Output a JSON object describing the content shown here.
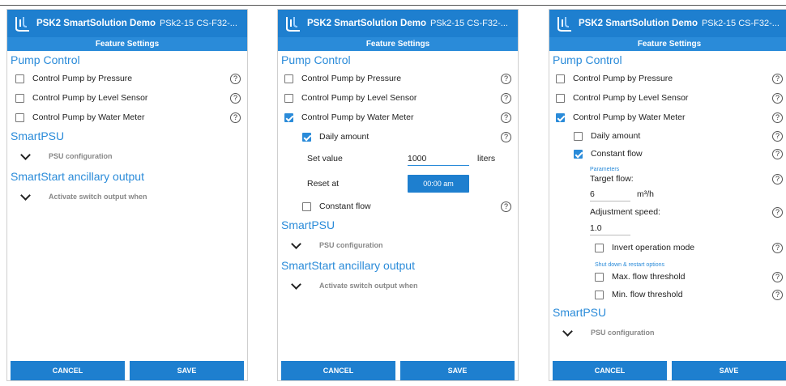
{
  "app": {
    "title": "PSK2 SmartSolution Demo",
    "subtitle": "PSk2-15 CS-F32-...",
    "subbar": "Feature Settings"
  },
  "common": {
    "pump_control": "Pump Control",
    "by_pressure": "Control Pump by Pressure",
    "by_level": "Control Pump by Level Sensor",
    "by_water_meter": "Control Pump by Water Meter",
    "smartpsu": "SmartPSU",
    "psu_configuration": "PSU configuration",
    "smartstart": "SmartStart ancillary output",
    "activate_switch": "Activate switch output when",
    "help": "?",
    "cancel": "CANCEL",
    "save": "SAVE"
  },
  "screen2": {
    "daily_amount": "Daily amount",
    "set_value_label": "Set value",
    "set_value": "1000",
    "liters": "liters",
    "reset_at_label": "Reset at",
    "reset_at": "00:00 am",
    "constant_flow": "Constant flow"
  },
  "screen3": {
    "daily_amount": "Daily amount",
    "constant_flow": "Constant flow",
    "parameters": "Parameters",
    "target_flow_label": "Target flow:",
    "target_flow": "6",
    "target_flow_unit": "m³/h",
    "adjustment_speed_label": "Adjustment speed:",
    "adjustment_speed": "1.0",
    "invert_operation": "Invert operation mode",
    "shutdown_caption": "Shut down & restart options",
    "max_flow": "Max. flow threshold",
    "min_flow": "Min. flow threshold",
    "smartpsu": "SmartPSU",
    "psu_configuration": "PSU configuration"
  },
  "colors": {
    "accent": "#1e7fcf",
    "section_title": "#2a8bd9"
  },
  "icons": {
    "app_logo": "pump-logo-icon",
    "help": "help-circle-icon",
    "expand": "chevron-down-icon"
  }
}
